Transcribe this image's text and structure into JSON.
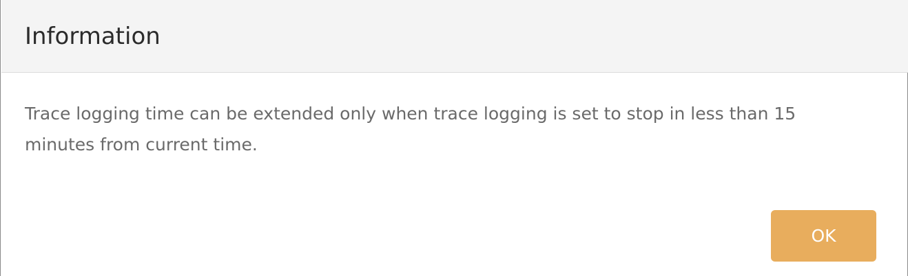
{
  "dialog": {
    "title": "Information",
    "message": "Trace logging time can be extended only when trace logging is set to stop in less than 15 minutes from current time.",
    "ok_label": "OK"
  },
  "colors": {
    "header_background": "#f4f4f4",
    "button_background": "#e8ad5d",
    "button_text": "#ffffff",
    "message_text": "#6a6a6a",
    "title_text": "#2b2b2b"
  }
}
